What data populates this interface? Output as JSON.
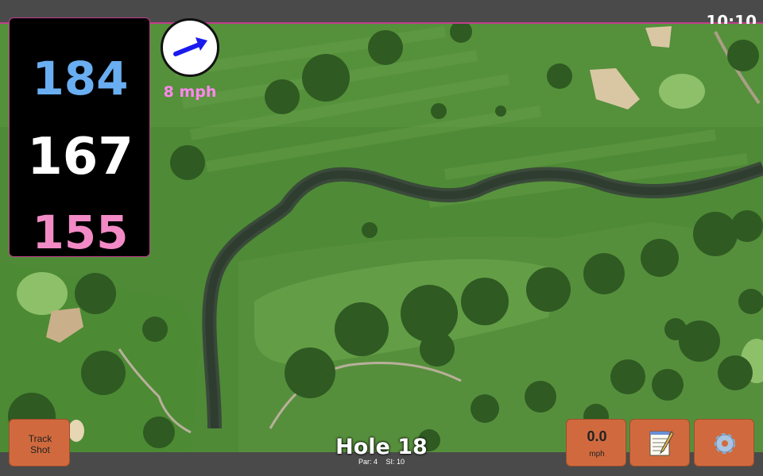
{
  "status_bar": {
    "time": "10:10"
  },
  "distances": {
    "back": "184",
    "middle": "167",
    "front": "155"
  },
  "wind": {
    "speed_label": "8 mph",
    "direction_icon": "arrow-up-right-icon",
    "arrow_color": "#1a1aee"
  },
  "hole": {
    "title": "Hole 18",
    "par": "Par: 4",
    "stroke_index": "SI: 10"
  },
  "buttons": {
    "track_shot": {
      "line1": "Track",
      "line2": "Shot"
    },
    "speed": {
      "value": "0.0",
      "unit": "mph"
    },
    "notes": {
      "icon": "notepad-icon"
    },
    "settings": {
      "icon": "gear-icon"
    }
  },
  "colors": {
    "accent": "#c23d8e",
    "back_distance": "#6aaef2",
    "middle_distance": "#ffffff",
    "front_distance": "#f28ac6",
    "wind_speed": "#ff88ee",
    "button": "#d06a3e"
  }
}
